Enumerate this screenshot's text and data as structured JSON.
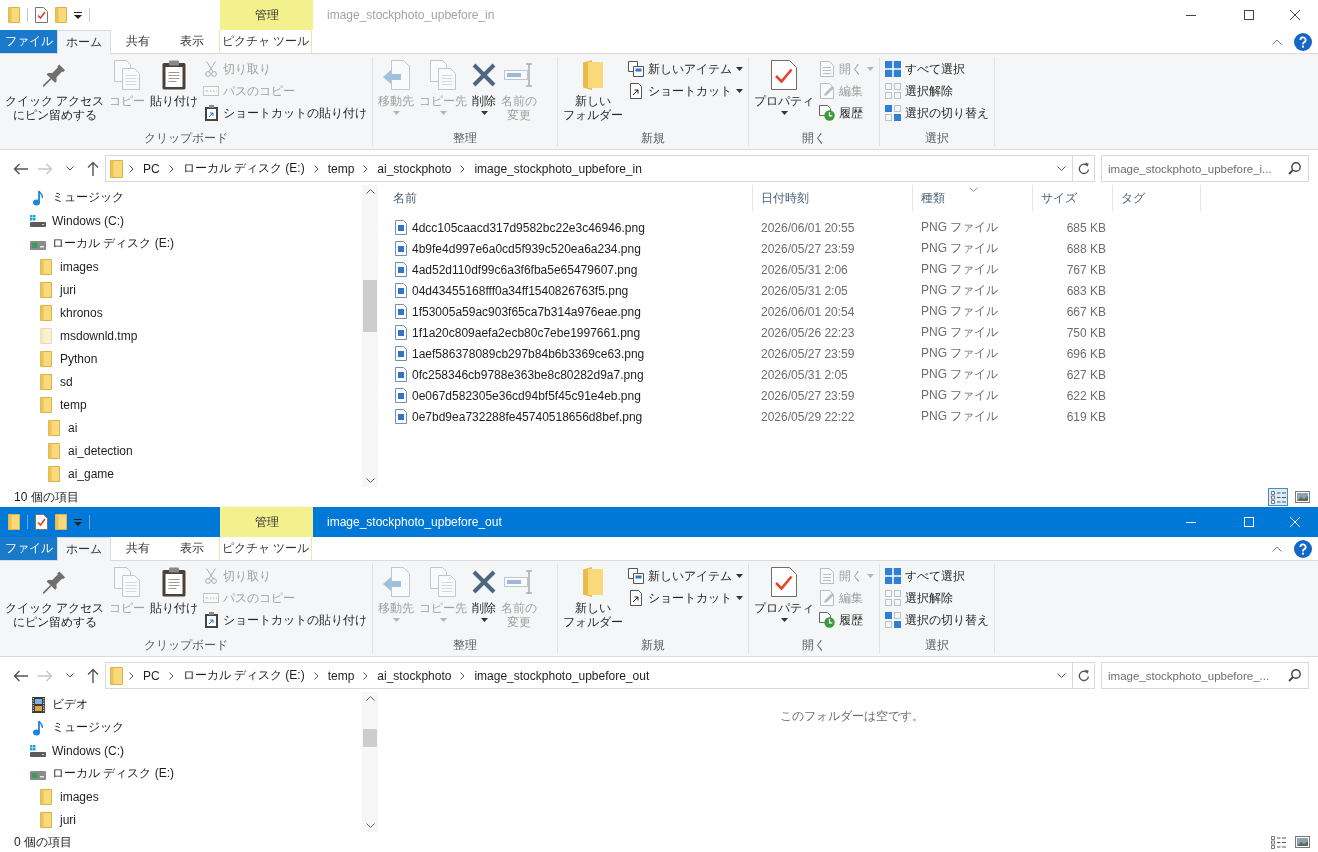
{
  "windows": [
    {
      "active": false,
      "title": "image_stockphoto_upbefore_in",
      "context_header": "管理",
      "tabs": [
        {
          "kind": "file",
          "label": "ファイル",
          "selected": false
        },
        {
          "kind": "tab",
          "label": "ホーム",
          "selected": true
        },
        {
          "kind": "tab",
          "label": "共有",
          "selected": false
        },
        {
          "kind": "tab",
          "label": "表示",
          "selected": false
        },
        {
          "kind": "context",
          "label": "ピクチャ ツール",
          "selected": false
        }
      ],
      "ribbon": [
        {
          "label": "クリップボード",
          "buttons": [
            {
              "kind": "pin",
              "lines": [
                "クイック アクセス",
                "にピン留めする"
              ],
              "disabled": false,
              "dropdown": false
            },
            {
              "kind": "copy",
              "lines": [
                "コピー"
              ],
              "disabled": true,
              "dropdown": false
            },
            {
              "kind": "paste",
              "lines": [
                "貼り付け"
              ],
              "disabled": false,
              "dropdown": false
            },
            {
              "kind": "cut",
              "label": "切り取り",
              "disabled": true,
              "dropdown": false
            },
            {
              "kind": "copy-path",
              "label": "パスのコピー",
              "disabled": true,
              "dropdown": false
            },
            {
              "kind": "paste-shortcut",
              "label": "ショートカットの貼り付け",
              "disabled": false,
              "dropdown": false
            }
          ]
        },
        {
          "label": "整理",
          "buttons": [
            {
              "kind": "move-to",
              "lines": [
                "移動先"
              ],
              "disabled": true,
              "dropdown": true
            },
            {
              "kind": "copy-to",
              "lines": [
                "コピー先"
              ],
              "disabled": true,
              "dropdown": true
            },
            {
              "kind": "delete",
              "lines": [
                "削除"
              ],
              "disabled": false,
              "dropdown": true
            },
            {
              "kind": "rename",
              "lines": [
                "名前の",
                "変更"
              ],
              "disabled": true,
              "dropdown": false
            }
          ]
        },
        {
          "label": "新規",
          "buttons": [
            {
              "kind": "new-folder",
              "lines": [
                "新しい",
                "フォルダー"
              ],
              "disabled": false,
              "dropdown": false
            },
            {
              "kind": "new-item",
              "label": "新しいアイテム",
              "disabled": false,
              "dropdown": true
            },
            {
              "kind": "shortcut",
              "label": "ショートカット",
              "disabled": false,
              "dropdown": true
            }
          ]
        },
        {
          "label": "開く",
          "buttons": [
            {
              "kind": "properties",
              "lines": [
                "プロパティ"
              ],
              "disabled": false,
              "dropdown": true
            },
            {
              "kind": "open",
              "label": "開く",
              "disabled": true,
              "dropdown": true
            },
            {
              "kind": "edit",
              "label": "編集",
              "disabled": true,
              "dropdown": false
            },
            {
              "kind": "history",
              "label": "履歴",
              "disabled": false,
              "dropdown": false
            }
          ]
        },
        {
          "label": "選択",
          "buttons": [
            {
              "kind": "select-all",
              "label": "すべて選択",
              "disabled": false,
              "dropdown": false
            },
            {
              "kind": "select-none",
              "label": "選択解除",
              "disabled": false,
              "dropdown": false
            },
            {
              "kind": "invert",
              "label": "選択の切り替え",
              "disabled": false,
              "dropdown": false
            }
          ]
        }
      ],
      "nav_buttons": [
        {
          "kind": "back",
          "disabled": false
        },
        {
          "kind": "forward",
          "disabled": true
        },
        {
          "kind": "recent",
          "disabled": false
        },
        {
          "kind": "up",
          "disabled": false
        }
      ],
      "address": {
        "crumbs": [
          "PC",
          "ローカル ディスク (E:)",
          "temp",
          "ai_stockphoto",
          "image_stockphoto_upbefore_in"
        ]
      },
      "search": {
        "placeholder": "image_stockphoto_upbefore_i..."
      },
      "tree": [
        {
          "kind": "music",
          "label": "ミュージック"
        },
        {
          "kind": "system-drive",
          "label": "Windows (C:)"
        },
        {
          "kind": "drive",
          "label": "ローカル ディスク (E:)",
          "children": [
            {
              "kind": "folder",
              "label": "images"
            },
            {
              "kind": "folder",
              "label": "juri"
            },
            {
              "kind": "folder",
              "label": "khronos"
            },
            {
              "kind": "hidden-folder",
              "label": "msdownld.tmp"
            },
            {
              "kind": "folder",
              "label": "Python"
            },
            {
              "kind": "folder",
              "label": "sd"
            },
            {
              "kind": "folder",
              "label": "temp",
              "children": [
                {
                  "kind": "folder",
                  "label": "ai"
                },
                {
                  "kind": "folder",
                  "label": "ai_detection"
                },
                {
                  "kind": "folder",
                  "label": "ai_game"
                }
              ]
            }
          ]
        }
      ],
      "file_list": {
        "columns": [
          {
            "label": "名前",
            "sorted": false
          },
          {
            "label": "日付時刻",
            "sorted": false
          },
          {
            "label": "種類",
            "sorted": true
          },
          {
            "label": "サイズ",
            "sorted": false
          },
          {
            "label": "タグ",
            "sorted": false
          }
        ],
        "rows": [
          {
            "name": "4dcc105caacd317d9582bc22e3c46946.png",
            "date": "2026/06/01 20:55",
            "type": "PNG ファイル",
            "size": "685 KB"
          },
          {
            "name": "4b9fe4d997e6a0cd5f939c520ea6a234.png",
            "date": "2026/05/27 23:59",
            "type": "PNG ファイル",
            "size": "688 KB"
          },
          {
            "name": "4ad52d110df99c6a3f6fba5e65479607.png",
            "date": "2026/05/31 2:06",
            "type": "PNG ファイル",
            "size": "767 KB"
          },
          {
            "name": "04d43455168fff0a34ff1540826763f5.png",
            "date": "2026/05/31 2:05",
            "type": "PNG ファイル",
            "size": "683 KB"
          },
          {
            "name": "1f53005a59ac903f65ca7b314a976eae.png",
            "date": "2026/06/01 20:54",
            "type": "PNG ファイル",
            "size": "667 KB"
          },
          {
            "name": "1f1a20c809aefa2ecb80c7ebe1997661.png",
            "date": "2026/05/26 22:23",
            "type": "PNG ファイル",
            "size": "750 KB"
          },
          {
            "name": "1aef586378089cb297b84b6b3369ce63.png",
            "date": "2026/05/27 23:59",
            "type": "PNG ファイル",
            "size": "696 KB"
          },
          {
            "name": "0fc258346cb9788e363be8c80282d9a7.png",
            "date": "2026/05/31 2:05",
            "type": "PNG ファイル",
            "size": "627 KB"
          },
          {
            "name": "0e067d582305e36cd94bf5f45c91e4eb.png",
            "date": "2026/05/27 23:59",
            "type": "PNG ファイル",
            "size": "622 KB"
          },
          {
            "name": "0e7bd9ea732288fe45740518656d8bef.png",
            "date": "2026/05/29 22:22",
            "type": "PNG ファイル",
            "size": "619 KB"
          }
        ]
      },
      "status": "10 個の項目",
      "views": [
        {
          "kind": "details",
          "selected": true
        },
        {
          "kind": "large-icons",
          "selected": false
        }
      ]
    },
    {
      "active": true,
      "title": "image_stockphoto_upbefore_out",
      "context_header": "管理",
      "tabs": [
        {
          "kind": "file",
          "label": "ファイル",
          "selected": false
        },
        {
          "kind": "tab",
          "label": "ホーム",
          "selected": true
        },
        {
          "kind": "tab",
          "label": "共有",
          "selected": false
        },
        {
          "kind": "tab",
          "label": "表示",
          "selected": false
        },
        {
          "kind": "context",
          "label": "ピクチャ ツール",
          "selected": false
        }
      ],
      "ribbon": [
        {
          "label": "クリップボード",
          "buttons": [
            {
              "kind": "pin",
              "lines": [
                "クイック アクセス",
                "にピン留めする"
              ],
              "disabled": false,
              "dropdown": false
            },
            {
              "kind": "copy",
              "lines": [
                "コピー"
              ],
              "disabled": true,
              "dropdown": false
            },
            {
              "kind": "paste",
              "lines": [
                "貼り付け"
              ],
              "disabled": false,
              "dropdown": false
            },
            {
              "kind": "cut",
              "label": "切り取り",
              "disabled": true,
              "dropdown": false
            },
            {
              "kind": "copy-path",
              "label": "パスのコピー",
              "disabled": true,
              "dropdown": false
            },
            {
              "kind": "paste-shortcut",
              "label": "ショートカットの貼り付け",
              "disabled": false,
              "dropdown": false
            }
          ]
        },
        {
          "label": "整理",
          "buttons": [
            {
              "kind": "move-to",
              "lines": [
                "移動先"
              ],
              "disabled": true,
              "dropdown": true
            },
            {
              "kind": "copy-to",
              "lines": [
                "コピー先"
              ],
              "disabled": true,
              "dropdown": true
            },
            {
              "kind": "delete",
              "lines": [
                "削除"
              ],
              "disabled": false,
              "dropdown": true
            },
            {
              "kind": "rename",
              "lines": [
                "名前の",
                "変更"
              ],
              "disabled": true,
              "dropdown": false
            }
          ]
        },
        {
          "label": "新規",
          "buttons": [
            {
              "kind": "new-folder",
              "lines": [
                "新しい",
                "フォルダー"
              ],
              "disabled": false,
              "dropdown": false
            },
            {
              "kind": "new-item",
              "label": "新しいアイテム",
              "disabled": false,
              "dropdown": true
            },
            {
              "kind": "shortcut",
              "label": "ショートカット",
              "disabled": false,
              "dropdown": true
            }
          ]
        },
        {
          "label": "開く",
          "buttons": [
            {
              "kind": "properties",
              "lines": [
                "プロパティ"
              ],
              "disabled": false,
              "dropdown": true
            },
            {
              "kind": "open",
              "label": "開く",
              "disabled": true,
              "dropdown": true
            },
            {
              "kind": "edit",
              "label": "編集",
              "disabled": true,
              "dropdown": false
            },
            {
              "kind": "history",
              "label": "履歴",
              "disabled": false,
              "dropdown": false
            }
          ]
        },
        {
          "label": "選択",
          "buttons": [
            {
              "kind": "select-all",
              "label": "すべて選択",
              "disabled": false,
              "dropdown": false
            },
            {
              "kind": "select-none",
              "label": "選択解除",
              "disabled": false,
              "dropdown": false
            },
            {
              "kind": "invert",
              "label": "選択の切り替え",
              "disabled": false,
              "dropdown": false
            }
          ]
        }
      ],
      "nav_buttons": [
        {
          "kind": "back",
          "disabled": false
        },
        {
          "kind": "forward",
          "disabled": true
        },
        {
          "kind": "recent",
          "disabled": false
        },
        {
          "kind": "up",
          "disabled": false
        }
      ],
      "address": {
        "crumbs": [
          "PC",
          "ローカル ディスク (E:)",
          "temp",
          "ai_stockphoto",
          "image_stockphoto_upbefore_out"
        ]
      },
      "search": {
        "placeholder": "image_stockphoto_upbefore_..."
      },
      "tree": [
        {
          "kind": "video",
          "label": "ビデオ"
        },
        {
          "kind": "music",
          "label": "ミュージック"
        },
        {
          "kind": "system-drive",
          "label": "Windows (C:)"
        },
        {
          "kind": "drive",
          "label": "ローカル ディスク (E:)",
          "children": [
            {
              "kind": "folder",
              "label": "images"
            },
            {
              "kind": "folder",
              "label": "juri"
            }
          ]
        }
      ],
      "file_list": {
        "empty_message": "このフォルダーは空です。"
      },
      "status": "0 個の項目",
      "views": [
        {
          "kind": "details",
          "selected": false
        },
        {
          "kind": "large-icons",
          "selected": false
        }
      ]
    }
  ]
}
